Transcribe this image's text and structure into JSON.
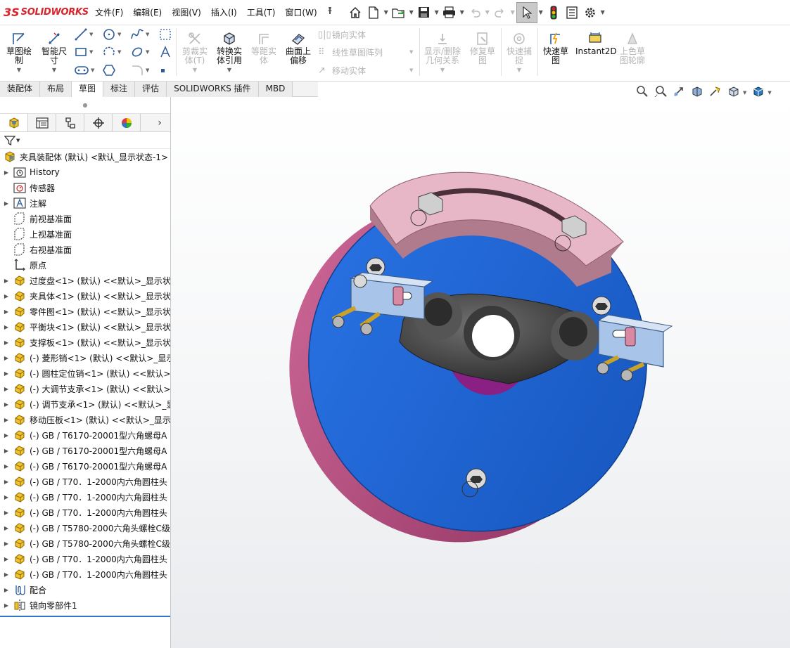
{
  "app": {
    "logo_mark": "3S",
    "logo_text": "SOLIDWORKS"
  },
  "menus": [
    "文件(F)",
    "编辑(E)",
    "视图(V)",
    "插入(I)",
    "工具(T)",
    "窗口(W)"
  ],
  "quick_tools": [
    "home-icon",
    "new-document-icon",
    "open-icon",
    "save-icon",
    "print-icon",
    "undo-icon",
    "redo-icon",
    "select-arrow-icon",
    "rebuild-traffic-light-icon",
    "file-properties-icon",
    "options-gear-icon"
  ],
  "ribbon": {
    "sketch": "草图绘\n制",
    "smart_dim": "智能尺\n寸",
    "trim": "剪裁实\n体(T)",
    "convert": "转换实\n体引用",
    "offset": "等距实\n体",
    "surface_offset": "曲面上\n偏移",
    "mirror": "镜向实体",
    "linear_pattern": "线性草图阵列",
    "move": "移动实体",
    "show_relations": "显示/删除\n几何关系",
    "repair": "修复草\n图",
    "quick_snap": "快速捕\n捉",
    "rapid_sketch": "快速草\n图",
    "instant2d": "Instant2D",
    "shaded_sketch": "上色草\n图轮廓"
  },
  "cm_tabs": [
    "装配体",
    "布局",
    "草图",
    "标注",
    "评估",
    "SOLIDWORKS 插件",
    "MBD"
  ],
  "cm_active": "草图",
  "hud_tools": [
    "zoom-to-fit-icon",
    "zoom-to-area-icon",
    "previous-view-icon",
    "section-view-icon",
    "dynamic-annotation-icon",
    "view-orientation-icon",
    "display-style-icon"
  ],
  "feature_manager": {
    "root": "夹具装配体 (默认) <默认_显示状态-1>",
    "items": [
      {
        "label": "History",
        "icon": "history-folder-icon",
        "expand": true
      },
      {
        "label": "传感器",
        "icon": "sensor-icon",
        "expand": false
      },
      {
        "label": "注解",
        "icon": "annotation-icon",
        "expand": true
      },
      {
        "label": "前视基准面",
        "icon": "plane-icon",
        "expand": false
      },
      {
        "label": "上视基准面",
        "icon": "plane-icon",
        "expand": false
      },
      {
        "label": "右视基准面",
        "icon": "plane-icon",
        "expand": false
      },
      {
        "label": "原点",
        "icon": "origin-icon",
        "expand": false
      },
      {
        "label": "过度盘<1> (默认) <<默认>_显示状",
        "icon": "part-icon",
        "expand": true
      },
      {
        "label": "夹具体<1> (默认) <<默认>_显示状",
        "icon": "part-icon",
        "expand": true
      },
      {
        "label": "零件图<1> (默认) <<默认>_显示状",
        "icon": "part-icon",
        "expand": true
      },
      {
        "label": "平衡块<1> (默认) <<默认>_显示状",
        "icon": "part-icon",
        "expand": true
      },
      {
        "label": "支撑板<1> (默认) <<默认>_显示状",
        "icon": "part-icon",
        "expand": true
      },
      {
        "label": "(-) 菱形销<1> (默认) <<默认>_显示",
        "icon": "part-icon",
        "expand": true
      },
      {
        "label": "(-) 圆柱定位销<1> (默认) <<默认>",
        "icon": "part-icon",
        "expand": true
      },
      {
        "label": "(-) 大调节支承<1> (默认) <<默认>_",
        "icon": "part-icon",
        "expand": true
      },
      {
        "label": "(-) 调节支承<1> (默认) <<默认>_显",
        "icon": "part-icon",
        "expand": true
      },
      {
        "label": "移动压板<1> (默认) <<默认>_显示",
        "icon": "part-icon",
        "expand": true
      },
      {
        "label": "(-) GB / T6170-20001型六角螺母A",
        "icon": "part-icon",
        "expand": true
      },
      {
        "label": "(-) GB / T6170-20001型六角螺母A",
        "icon": "part-icon",
        "expand": true
      },
      {
        "label": "(-) GB / T6170-20001型六角螺母A",
        "icon": "part-icon",
        "expand": true
      },
      {
        "label": "(-) GB / T70．1-2000内六角圆柱头",
        "icon": "part-icon",
        "expand": true
      },
      {
        "label": "(-) GB / T70．1-2000内六角圆柱头",
        "icon": "part-icon",
        "expand": true
      },
      {
        "label": "(-) GB / T70．1-2000内六角圆柱头",
        "icon": "part-icon",
        "expand": true
      },
      {
        "label": "(-) GB / T5780-2000六角头螺栓C级",
        "icon": "part-icon",
        "expand": true
      },
      {
        "label": "(-) GB / T5780-2000六角头螺栓C级",
        "icon": "part-icon",
        "expand": true
      },
      {
        "label": "(-) GB / T70．1-2000内六角圆柱头",
        "icon": "part-icon",
        "expand": true
      },
      {
        "label": "(-) GB / T70．1-2000内六角圆柱头",
        "icon": "part-icon",
        "expand": true
      },
      {
        "label": "配合",
        "icon": "mates-icon",
        "expand": true
      },
      {
        "label": "镜向零部件1",
        "icon": "mirror-component-icon",
        "expand": true
      }
    ]
  },
  "colors": {
    "plate_blue": "#1e66d6",
    "disk_magenta": "#b5427a",
    "arc_pink": "#e7b7c7",
    "clamp_blue": "#a8c4e8",
    "body_dark": "#4a4a4a",
    "bore_magenta": "#e23ad1",
    "selection_blue": "#2d78c4"
  }
}
